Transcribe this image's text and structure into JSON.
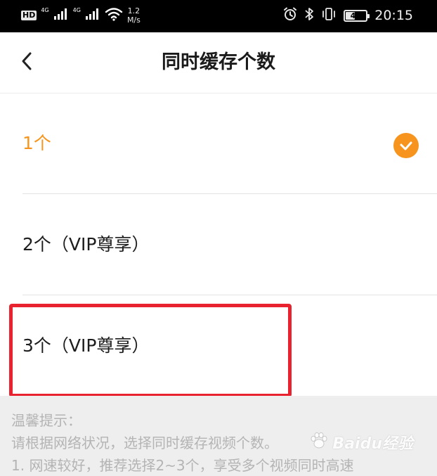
{
  "status_bar": {
    "hd_badge": "HD",
    "signal_1_label": "4G",
    "signal_2_label": "4G",
    "net_speed_value": "1.2",
    "net_speed_unit": "M/s",
    "battery_level": "47",
    "time": "20:15",
    "icons": [
      "alarm-icon",
      "bluetooth-icon",
      "vibrate-icon",
      "battery-icon",
      "wifi-icon",
      "signal-icon"
    ]
  },
  "header": {
    "title": "同时缓存个数",
    "back_icon": "chevron-left-icon"
  },
  "options": [
    {
      "label": "1个",
      "selected": true
    },
    {
      "label": "2个（VIP尊享）",
      "selected": false
    },
    {
      "label": "3个（VIP尊享）",
      "selected": false
    }
  ],
  "tips": {
    "title": "温馨提示：",
    "line1": "请根据网络状况，选择同时缓存视频个数。",
    "line2": "1. 网速较好，推荐选择2~3个，享受多个视频同时高速"
  },
  "watermark": {
    "text": "Baidu经验"
  },
  "colors": {
    "accent": "#f7941d",
    "highlight_box": "#e8232f",
    "status_bar_bg": "#000000",
    "tips_bg": "#eeeeee"
  }
}
